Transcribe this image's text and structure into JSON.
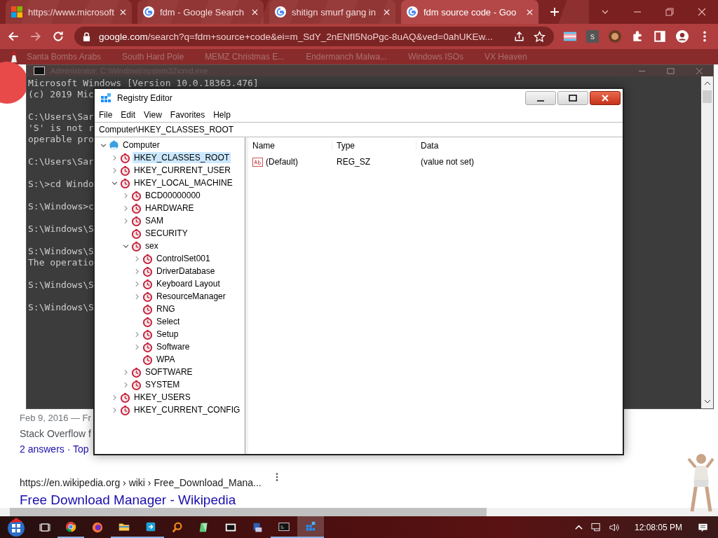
{
  "browser": {
    "tabs": [
      {
        "title": "https://www.microsoft",
        "kind": "windows",
        "selected": false
      },
      {
        "title": "fdm - Google Search",
        "kind": "google",
        "selected": false
      },
      {
        "title": "shitign smurf gang in",
        "kind": "google",
        "selected": false
      },
      {
        "title": "fdm source code - Goo",
        "kind": "google",
        "selected": true
      }
    ],
    "url_host": "google.com",
    "url_rest": "/search?q=fdm+source+code&ei=m_SdY_2nENfI5NoPgc-8uAQ&ved=0ahUKEw...",
    "extension_letter": "s",
    "bookmarks": [
      "Santa Bombs Arabs",
      "South Hard Pole",
      "MEMZ Christmas E...",
      "Endermanch Malwa...",
      "Windows ISOs",
      "VX Heaven"
    ]
  },
  "page": {
    "results": [
      {
        "kind": "date",
        "text": "Feb 9, 2016 — Fr"
      },
      {
        "kind": "snippet",
        "text": "Stack Overflow f"
      },
      {
        "kind": "link",
        "text": "2 answers · Top"
      },
      {
        "kind": "url",
        "text": "https://en.wikipedia.org › wiki › Free_Download_Mana..."
      },
      {
        "kind": "title",
        "text": "Free Download Manager - Wikipedia"
      }
    ]
  },
  "cmd": {
    "title": "Administrator: C:\\Windows\\system32\\cmd.exe",
    "blocks": [
      [
        "Microsoft Windows [Version 10.0.18363.476]",
        "(c) 2019 Mic"
      ],
      [
        "C:\\Users\\Sar",
        "'S' is not r",
        "operable pro"
      ],
      [
        "C:\\Users\\Sar"
      ],
      [
        "S:\\>cd Windo"
      ],
      [
        "S:\\Windows>c"
      ],
      [
        "S:\\Windows\\S"
      ],
      [
        "S:\\Windows\\S",
        "The operatio"
      ],
      [
        "S:\\Windows\\S"
      ],
      [
        "S:\\Windows\\S"
      ]
    ]
  },
  "registry": {
    "title": "Registry Editor",
    "menu": [
      "File",
      "Edit",
      "View",
      "Favorites",
      "Help"
    ],
    "address": "Computer\\HKEY_CLASSES_ROOT",
    "columns": [
      "Name",
      "Type",
      "Data"
    ],
    "values": [
      {
        "name": "(Default)",
        "type": "REG_SZ",
        "data": "(value not set)"
      }
    ],
    "tree": {
      "label": "Computer",
      "kind": "computer",
      "expandable": true,
      "expanded": true,
      "selected": false,
      "children": [
        {
          "label": "HKEY_CLASSES_ROOT",
          "expandable": true,
          "expanded": false,
          "selected": true
        },
        {
          "label": "HKEY_CURRENT_USER",
          "expandable": true,
          "expanded": false,
          "selected": false
        },
        {
          "label": "HKEY_LOCAL_MACHINE",
          "expandable": true,
          "expanded": true,
          "selected": false,
          "children": [
            {
              "label": "BCD00000000",
              "expandable": true,
              "expanded": false,
              "selected": false
            },
            {
              "label": "HARDWARE",
              "expandable": true,
              "expanded": false,
              "selected": false
            },
            {
              "label": "SAM",
              "expandable": true,
              "expanded": false,
              "selected": false
            },
            {
              "label": "SECURITY",
              "expandable": false,
              "expanded": false,
              "selected": false
            },
            {
              "label": "sex",
              "expandable": true,
              "expanded": true,
              "selected": false,
              "children": [
                {
                  "label": "ControlSet001",
                  "expandable": true,
                  "expanded": false,
                  "selected": false
                },
                {
                  "label": "DriverDatabase",
                  "expandable": true,
                  "expanded": false,
                  "selected": false
                },
                {
                  "label": "Keyboard Layout",
                  "expandable": true,
                  "expanded": false,
                  "selected": false
                },
                {
                  "label": "ResourceManager",
                  "expandable": true,
                  "expanded": false,
                  "selected": false
                },
                {
                  "label": "RNG",
                  "expandable": false,
                  "expanded": false,
                  "selected": false
                },
                {
                  "label": "Select",
                  "expandable": false,
                  "expanded": false,
                  "selected": false
                },
                {
                  "label": "Setup",
                  "expandable": true,
                  "expanded": false,
                  "selected": false
                },
                {
                  "label": "Software",
                  "expandable": true,
                  "expanded": false,
                  "selected": false
                },
                {
                  "label": "WPA",
                  "expandable": false,
                  "expanded": false,
                  "selected": false
                }
              ]
            },
            {
              "label": "SOFTWARE",
              "expandable": true,
              "expanded": false,
              "selected": false
            },
            {
              "label": "SYSTEM",
              "expandable": true,
              "expanded": false,
              "selected": false
            }
          ]
        },
        {
          "label": "HKEY_USERS",
          "expandable": true,
          "expanded": false,
          "selected": false
        },
        {
          "label": "HKEY_CURRENT_CONFIG",
          "expandable": true,
          "expanded": false,
          "selected": false
        }
      ]
    }
  },
  "taskbar": {
    "apps": [
      {
        "kind": "chrome",
        "running": true,
        "active": false
      },
      {
        "kind": "firefox",
        "running": false,
        "active": false
      },
      {
        "kind": "folder",
        "running": true,
        "active": false
      },
      {
        "kind": "share",
        "running": true,
        "active": false
      },
      {
        "kind": "search",
        "running": false,
        "active": false
      },
      {
        "kind": "notes",
        "running": false,
        "active": false
      },
      {
        "kind": "zip",
        "running": false,
        "active": false
      },
      {
        "kind": "setup",
        "running": false,
        "active": false
      },
      {
        "kind": "cmd",
        "running": true,
        "active": false
      },
      {
        "kind": "regedit",
        "running": true,
        "active": true
      }
    ],
    "clock": "12:08:05 PM"
  }
}
